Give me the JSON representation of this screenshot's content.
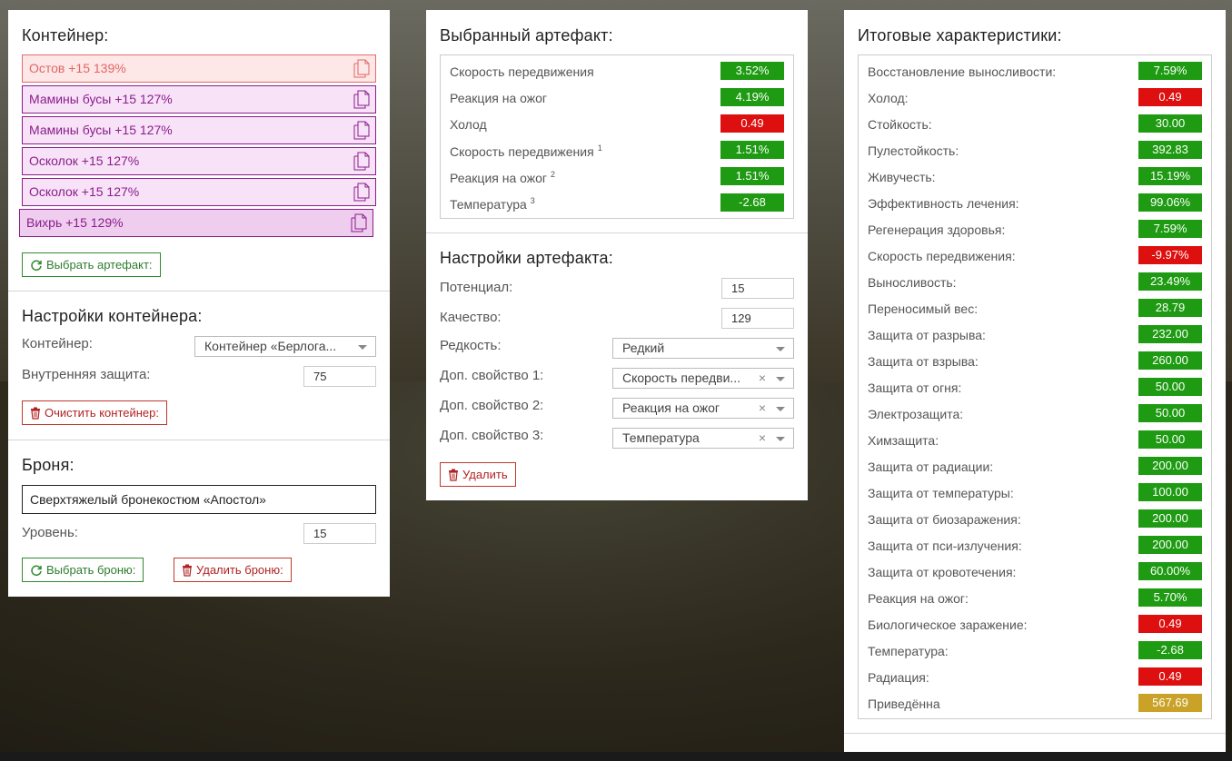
{
  "colors": {
    "good": "#1e9b12",
    "bad": "#dd0f0f",
    "neutral": "#c9a227"
  },
  "container": {
    "title": "Контейнер:",
    "slots": [
      {
        "label": "Остов +15 139%",
        "variant": "red"
      },
      {
        "label": "Мамины бусы +15 127%",
        "variant": "purple"
      },
      {
        "label": "Мамины бусы +15 127%",
        "variant": "purple"
      },
      {
        "label": "Осколок +15 127%",
        "variant": "purple"
      },
      {
        "label": "Осколок +15 127%",
        "variant": "purple"
      },
      {
        "label": "Вихрь +15 129%",
        "variant": "purple2"
      }
    ],
    "select_button": "Выбрать артефакт:"
  },
  "container_settings": {
    "title": "Настройки контейнера:",
    "container_label": "Контейнер:",
    "container_value": "Контейнер «Берлога...",
    "protection_label": "Внутренняя защита:",
    "protection_value": "75",
    "clear_button": "Очистить контейнер:"
  },
  "armor": {
    "title": "Броня:",
    "name": "Сверхтяжелый бронекостюм «Апостол»",
    "level_label": "Уровень:",
    "level_value": "15",
    "select_button": "Выбрать броню:",
    "delete_button": "Удалить броню:"
  },
  "selected_artifact": {
    "title": "Выбранный артефакт:",
    "stats": [
      {
        "name": "Скорость передвижения",
        "sup": "",
        "value": "3.52%",
        "status": "good"
      },
      {
        "name": "Реакция на ожог",
        "sup": "",
        "value": "4.19%",
        "status": "good"
      },
      {
        "name": "Холод",
        "sup": "",
        "value": "0.49",
        "status": "bad"
      },
      {
        "name": "Скорость передвижения",
        "sup": "1",
        "value": "1.51%",
        "status": "good"
      },
      {
        "name": "Реакция на ожог",
        "sup": "2",
        "value": "1.51%",
        "status": "good"
      },
      {
        "name": "Температура",
        "sup": "3",
        "value": "-2.68",
        "status": "good"
      }
    ]
  },
  "artifact_settings": {
    "title": "Настройки артефакта:",
    "potential_label": "Потенциал:",
    "potential_value": "15",
    "quality_label": "Качество:",
    "quality_value": "129",
    "rarity_label": "Редкость:",
    "rarity_value": "Редкий",
    "prop1_label": "Доп. свойство 1:",
    "prop1_value": "Скорость передви...",
    "prop2_label": "Доп. свойство 2:",
    "prop2_value": "Реакция на ожог",
    "prop3_label": "Доп. свойство 3:",
    "prop3_value": "Температура",
    "clear_symbol": "×",
    "delete_button": "Удалить"
  },
  "totals": {
    "title": "Итоговые характеристики:",
    "stats": [
      {
        "name": "Восстановление выносливости:",
        "value": "7.59%",
        "status": "good"
      },
      {
        "name": "Холод:",
        "value": "0.49",
        "status": "bad"
      },
      {
        "name": "Стойкость:",
        "value": "30.00",
        "status": "good"
      },
      {
        "name": "Пулестойкость:",
        "value": "392.83",
        "status": "good"
      },
      {
        "name": "Живучесть:",
        "value": "15.19%",
        "status": "good"
      },
      {
        "name": "Эффективность лечения:",
        "value": "99.06%",
        "status": "good"
      },
      {
        "name": "Регенерация здоровья:",
        "value": "7.59%",
        "status": "good"
      },
      {
        "name": "Скорость передвижения:",
        "value": "-9.97%",
        "status": "bad"
      },
      {
        "name": "Выносливость:",
        "value": "23.49%",
        "status": "good"
      },
      {
        "name": "Переносимый вес:",
        "value": "28.79",
        "status": "good"
      },
      {
        "name": "Защита от разрыва:",
        "value": "232.00",
        "status": "good"
      },
      {
        "name": "Защита от взрыва:",
        "value": "260.00",
        "status": "good"
      },
      {
        "name": "Защита от огня:",
        "value": "50.00",
        "status": "good"
      },
      {
        "name": "Электрозащита:",
        "value": "50.00",
        "status": "good"
      },
      {
        "name": "Химзащита:",
        "value": "50.00",
        "status": "good"
      },
      {
        "name": "Защита от радиации:",
        "value": "200.00",
        "status": "good"
      },
      {
        "name": "Защита от температуры:",
        "value": "100.00",
        "status": "good"
      },
      {
        "name": "Защита от биозаражения:",
        "value": "200.00",
        "status": "good"
      },
      {
        "name": "Защита от пси-излучения:",
        "value": "200.00",
        "status": "good"
      },
      {
        "name": "Защита от кровотечения:",
        "value": "60.00%",
        "status": "good"
      },
      {
        "name": "Реакция на ожог:",
        "value": "5.70%",
        "status": "good"
      },
      {
        "name": "Биологическое заражение:",
        "value": "0.49",
        "status": "bad"
      },
      {
        "name": "Температура:",
        "value": "-2.68",
        "status": "good"
      },
      {
        "name": "Радиация:",
        "value": "0.49",
        "status": "bad"
      },
      {
        "name": "Приведённа",
        "value": "567.69",
        "status": "neutral"
      }
    ]
  }
}
